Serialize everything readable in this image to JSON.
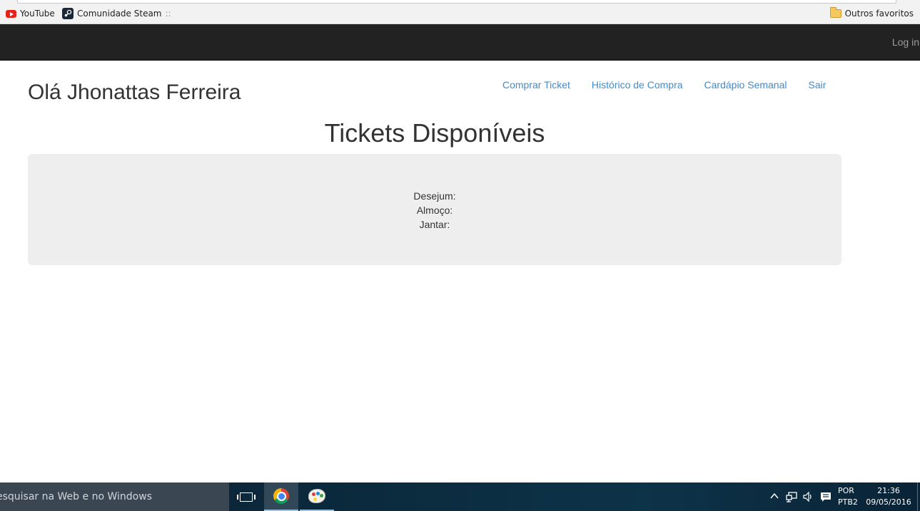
{
  "browser": {
    "bookmarks": [
      {
        "label": "YouTube",
        "icon": "youtube-icon"
      },
      {
        "label": "Comunidade Steam",
        "suffix": "::",
        "icon": "steam-icon"
      }
    ],
    "other_bookmarks": {
      "label": "Outros favoritos",
      "icon": "folder-icon"
    }
  },
  "navbar": {
    "login_label": "Log in",
    "background": "#222222"
  },
  "header": {
    "greeting": "Olá Jhonattas Ferreira",
    "nav_links": [
      {
        "label": "Comprar Ticket"
      },
      {
        "label": "Histórico de Compra"
      },
      {
        "label": "Cardápio Semanal"
      },
      {
        "label": "Sair"
      }
    ],
    "link_color": "#428bca"
  },
  "main": {
    "title": "Tickets Disponíveis",
    "tickets": [
      {
        "label": "Desejum:",
        "value": ""
      },
      {
        "label": "Almoço:",
        "value": ""
      },
      {
        "label": "Jantar:",
        "value": ""
      }
    ]
  },
  "taskbar": {
    "search_placeholder": "esquisar na Web e no Windows",
    "apps": [
      {
        "name": "task-view",
        "icon": "task-view-icon"
      },
      {
        "name": "chrome",
        "icon": "chrome-icon",
        "active": true
      },
      {
        "name": "paint",
        "icon": "paint-icon"
      }
    ],
    "language_top": "POR",
    "language_bottom": "PTB2",
    "time": "21:36",
    "date": "09/05/2016"
  }
}
